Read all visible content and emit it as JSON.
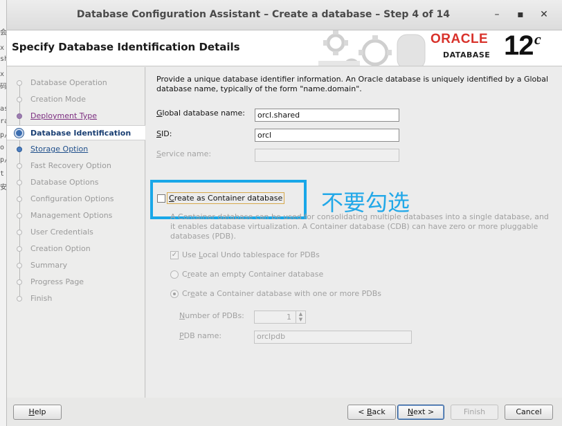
{
  "window": {
    "title": "Database Configuration Assistant – Create a database – Step 4 of 14",
    "minimize_glyph": "–",
    "maximize_glyph": "▪",
    "close_glyph": "✕"
  },
  "header": {
    "page_title": "Specify Database Identification Details",
    "brand_name": "ORACLE",
    "brand_product": "DATABASE",
    "brand_version": "12",
    "brand_version_suffix": "c"
  },
  "nav": {
    "items": [
      {
        "label": "Database Operation",
        "state": "disabled"
      },
      {
        "label": "Creation Mode",
        "state": "disabled"
      },
      {
        "label": "Deployment Type",
        "state": "visited"
      },
      {
        "label": "Database Identification",
        "state": "current"
      },
      {
        "label": "Storage Option",
        "state": "link"
      },
      {
        "label": "Fast Recovery Option",
        "state": "disabled"
      },
      {
        "label": "Database Options",
        "state": "disabled"
      },
      {
        "label": "Configuration Options",
        "state": "disabled"
      },
      {
        "label": "Management Options",
        "state": "disabled"
      },
      {
        "label": "User Credentials",
        "state": "disabled"
      },
      {
        "label": "Creation Option",
        "state": "disabled"
      },
      {
        "label": "Summary",
        "state": "disabled"
      },
      {
        "label": "Progress Page",
        "state": "disabled"
      },
      {
        "label": "Finish",
        "state": "disabled"
      }
    ]
  },
  "form": {
    "description": "Provide a unique database identifier information. An Oracle database is uniquely identified by a Global database name, typically of the form \"name.domain\".",
    "global_db_name": {
      "mnemonic": "G",
      "rest": "lobal database name:",
      "value": "orcl.shared"
    },
    "sid": {
      "mnemonic": "S",
      "rest": "ID:",
      "value": "orcl"
    },
    "service_name": {
      "mnemonic": "S",
      "rest": "ervice name:",
      "value": ""
    },
    "container": {
      "mnemonic": "C",
      "rest": "reate as Container database",
      "checked": false,
      "description": "A Container database can be used for consolidating multiple databases into a single database, and it enables database virtualization. A Container database (CDB) can have zero or more pluggable databases (PDB).",
      "local_undo": {
        "pre": "Use ",
        "mnemonic": "L",
        "rest": "ocal Undo tablespace for PDBs",
        "checked": true
      },
      "empty_option": {
        "pre": "C",
        "mnemonic": "r",
        "rest": "eate an empty Container database",
        "selected": false
      },
      "with_pdb_option": {
        "pre": "Cr",
        "mnemonic": "e",
        "rest": "ate a Container database with one or more PDBs",
        "selected": true
      },
      "num_pdbs": {
        "mnemonic": "N",
        "rest": "umber of PDBs:",
        "value": "1"
      },
      "pdb_name": {
        "mnemonic": "P",
        "rest": "DB name:",
        "value": "orclpdb"
      }
    },
    "annotation": "不要勾选",
    "annotation_color": "#22a8e8"
  },
  "buttons": {
    "help": {
      "mnemonic": "H",
      "rest": "elp"
    },
    "back": {
      "pre": "< ",
      "mnemonic": "B",
      "rest": "ack"
    },
    "next": {
      "mnemonic": "N",
      "rest": "ext >"
    },
    "finish": {
      "mnemonic": "",
      "rest": "Finish"
    },
    "cancel": {
      "mnemonic": "",
      "rest": "Cancel"
    }
  },
  "background_terminal": {
    "fragments": [
      "会",
      "x",
      "sh",
      "x",
      "码",
      "",
      "as",
      "ra",
      "p/",
      "o",
      "p/",
      "t",
      "安"
    ]
  }
}
